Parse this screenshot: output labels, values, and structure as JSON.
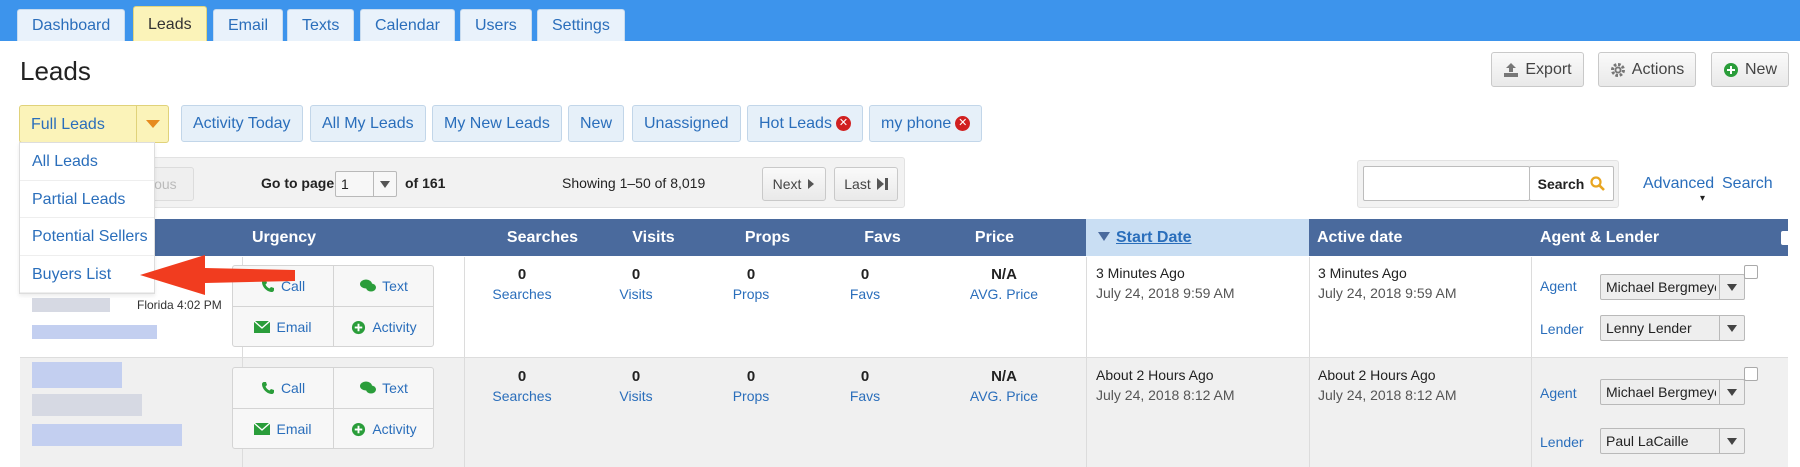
{
  "nav": {
    "tabs": [
      "Dashboard",
      "Leads",
      "Email",
      "Texts",
      "Calendar",
      "Users",
      "Settings"
    ],
    "active_tab": "Leads"
  },
  "page": {
    "title": "Leads",
    "export_label": "Export",
    "actions_label": "Actions",
    "new_label": "New"
  },
  "filters": {
    "selected": "Full Leads",
    "items": [
      "Activity Today",
      "All My Leads",
      "My New Leads",
      "New",
      "Unassigned",
      "Hot Leads",
      "my phone"
    ],
    "removable": [
      "Hot Leads",
      "my phone"
    ]
  },
  "dropdown": {
    "items": [
      "All Leads",
      "Partial Leads",
      "Potential Sellers",
      "Buyers List"
    ],
    "highlighted": "Buyers List"
  },
  "pager": {
    "previous_label": "ious",
    "go_to_label": "Go to page",
    "current_page": "1",
    "of_label": "of 161",
    "showing": "Showing 1–50 of 8,019",
    "next_label": "Next",
    "last_label": "Last"
  },
  "search": {
    "button_label": "Search",
    "input_value": "",
    "advanced_label": "Advanced",
    "advanced_search_label": "Search"
  },
  "table": {
    "headers": {
      "urgency": "Urgency",
      "searches": "Searches",
      "visits": "Visits",
      "props": "Props",
      "favs": "Favs",
      "price": "Price",
      "start_date": "Start Date",
      "active_date": "Active date",
      "agent_lender": "Agent & Lender"
    },
    "sorted_column": "Start Date",
    "action_labels": {
      "call": "Call",
      "text": "Text",
      "email": "Email",
      "activity": "Activity"
    },
    "agent_label": "Agent",
    "lender_label": "Lender",
    "rows": [
      {
        "location": "Florida",
        "time": "4:02 PM",
        "searches": "0",
        "searches_cap": "Searches",
        "visits": "0",
        "visits_cap": "Visits",
        "props": "0",
        "props_cap": "Props",
        "favs": "0",
        "favs_cap": "Favs",
        "price": "N/A",
        "price_cap": "AVG. Price",
        "start_rel": "3 Minutes Ago",
        "start_abs": "July 24, 2018 9:59 AM",
        "active_rel": "3 Minutes Ago",
        "active_abs": "July 24, 2018 9:59 AM",
        "agent": "Michael Bergmeyer",
        "lender": "Lenny Lender"
      },
      {
        "searches": "0",
        "searches_cap": "Searches",
        "visits": "0",
        "visits_cap": "Visits",
        "props": "0",
        "props_cap": "Props",
        "favs": "0",
        "favs_cap": "Favs",
        "price": "N/A",
        "price_cap": "AVG. Price",
        "start_rel": "About 2 Hours Ago",
        "start_abs": "July 24, 2018 8:12 AM",
        "active_rel": "About 2 Hours Ago",
        "active_abs": "July 24, 2018 8:12 AM",
        "agent": "Michael Bergmeyer",
        "lender": "Paul LaCaille"
      }
    ]
  },
  "colors": {
    "nav_bar": "#3d94ec",
    "active_tab": "#fbf3b9",
    "table_header": "#4a6a9d",
    "link": "#2a6ebb",
    "arrow": "#f13c1f",
    "action_icon": "#2a9d3a"
  },
  "icons": [
    "upload-icon",
    "gear-icon",
    "plus-circle-icon",
    "remove-icon",
    "search-icon",
    "phone-icon",
    "chat-icon",
    "envelope-icon",
    "plus-circle-icon",
    "caret-right-icon",
    "skip-end-icon",
    "sort-down-icon",
    "chevron-down-icon"
  ]
}
